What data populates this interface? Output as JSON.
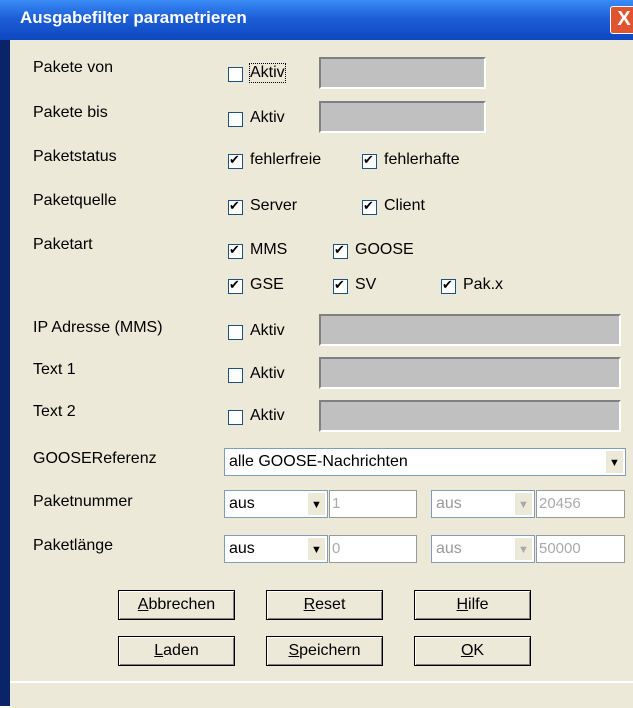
{
  "window": {
    "title": "Ausgabefilter parametrieren",
    "close_glyph": "X"
  },
  "rows": {
    "von": {
      "label": "Pakete von",
      "cb": "Aktiv"
    },
    "bis": {
      "label": "Pakete bis",
      "cb": "Aktiv"
    },
    "status": {
      "label": "Paketstatus",
      "cb1": "fehlerfreie",
      "cb2": "fehlerhafte"
    },
    "quelle": {
      "label": "Paketquelle",
      "cb1": "Server",
      "cb2": "Client"
    },
    "art": {
      "label": "Paketart",
      "mms": "MMS",
      "goose": "GOOSE",
      "gse": "GSE",
      "sv": "SV",
      "pakx": "Pak.x"
    },
    "ip": {
      "label": "IP Adresse (MMS)",
      "cb": "Aktiv"
    },
    "text1": {
      "label": "Text 1",
      "cb": "Aktiv"
    },
    "text2": {
      "label": "Text 2",
      "cb": "Aktiv"
    },
    "goose_ref": {
      "label": "GOOSEReferenz",
      "value": "alle GOOSE-Nachrichten"
    },
    "nummer": {
      "label": "Paketnummer",
      "combo1": "aus",
      "edit1": "1",
      "combo2": "aus",
      "edit2": "20456"
    },
    "laenge": {
      "label": "Paketlänge",
      "combo1": "aus",
      "edit1": "0",
      "combo2": "aus",
      "edit2": "50000"
    }
  },
  "buttons": {
    "abbrechen": {
      "u": "A",
      "rest": "bbrechen"
    },
    "reset": {
      "u": "R",
      "rest": "eset"
    },
    "hilfe": {
      "u": "H",
      "rest": "ilfe"
    },
    "laden": {
      "u": "L",
      "rest": "aden"
    },
    "speichern": {
      "u": "S",
      "rest": "peichern"
    },
    "ok": {
      "u": "O",
      "rest": "K"
    }
  }
}
